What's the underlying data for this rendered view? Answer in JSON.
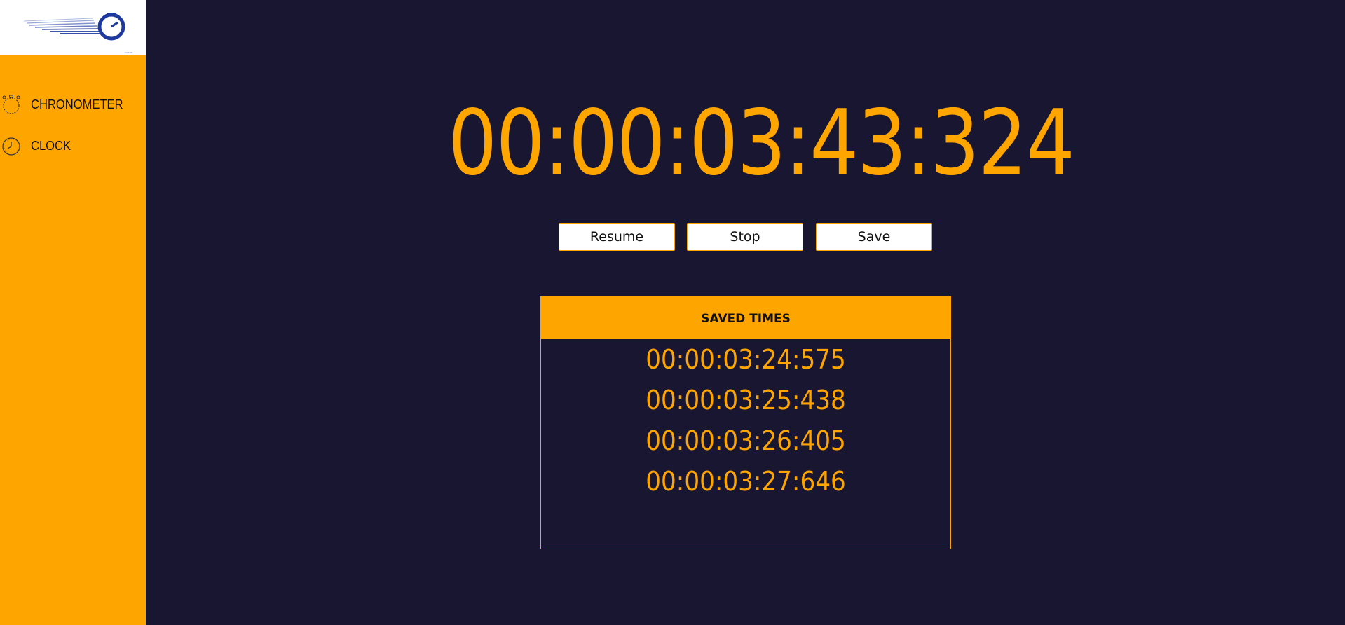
{
  "sidebar": {
    "logo": {
      "icon": "stopwatch-logo-icon"
    },
    "items": [
      {
        "label": "CHRONOMETER",
        "icon": "stopwatch-icon"
      },
      {
        "label": "CLOCK",
        "icon": "clock-icon"
      }
    ]
  },
  "timer": {
    "value": "00:00:03:43:324"
  },
  "controls": {
    "resume_label": "Resume",
    "stop_label": "Stop",
    "save_label": "Save"
  },
  "saved": {
    "title": "SAVED TIMES",
    "times": [
      "00:00:03:24:575",
      "00:00:03:25:438",
      "00:00:03:26:405",
      "00:00:03:27:646"
    ]
  },
  "colors": {
    "accent": "#FFA500",
    "background": "#181630",
    "logo_blue": "#1E3A9E"
  }
}
